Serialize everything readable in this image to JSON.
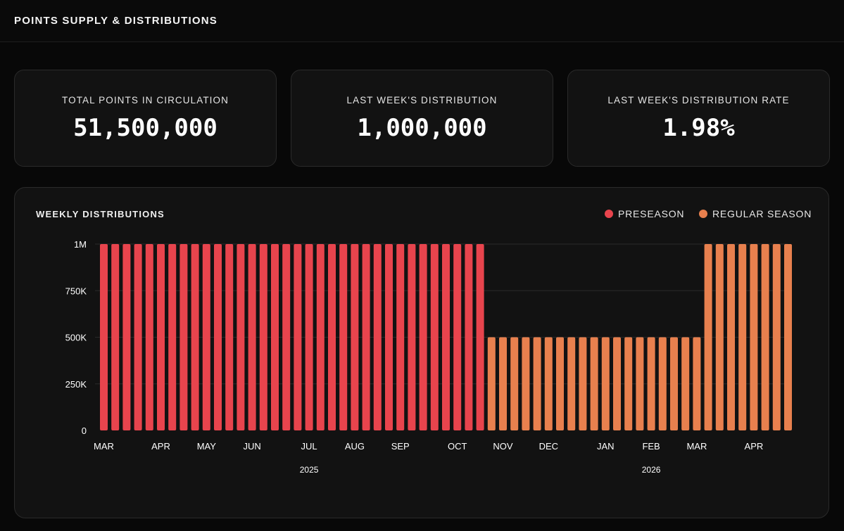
{
  "page": {
    "title": "POINTS SUPPLY & DISTRIBUTIONS"
  },
  "stats": [
    {
      "label": "TOTAL POINTS IN CIRCULATION",
      "value": "51,500,000"
    },
    {
      "label": "LAST WEEK'S DISTRIBUTION",
      "value": "1,000,000"
    },
    {
      "label": "LAST WEEK'S DISTRIBUTION RATE",
      "value": "1.98%"
    }
  ],
  "chart_card": {
    "title": "WEEKLY DISTRIBUTIONS",
    "legend": [
      {
        "label": "PRESEASON",
        "color": "#e8444d"
      },
      {
        "label": "REGULAR SEASON",
        "color": "#e8804e"
      }
    ]
  },
  "chart_data": {
    "type": "bar",
    "title": "WEEKLY DISTRIBUTIONS",
    "xlabel": "",
    "ylabel": "",
    "ylim": [
      0,
      1000000
    ],
    "yticks": [
      {
        "value": 0,
        "label": "0"
      },
      {
        "value": 250000,
        "label": "250K"
      },
      {
        "value": 500000,
        "label": "500K"
      },
      {
        "value": 750000,
        "label": "750K"
      },
      {
        "value": 1000000,
        "label": "1M"
      }
    ],
    "grid": true,
    "legend_position": "top-right",
    "month_labels": [
      {
        "label": "MAR",
        "week": 0
      },
      {
        "label": "APR",
        "week": 5
      },
      {
        "label": "MAY",
        "week": 9
      },
      {
        "label": "JUN",
        "week": 13
      },
      {
        "label": "JUL",
        "week": 18
      },
      {
        "label": "AUG",
        "week": 22
      },
      {
        "label": "SEP",
        "week": 26
      },
      {
        "label": "OCT",
        "week": 31
      },
      {
        "label": "NOV",
        "week": 35
      },
      {
        "label": "DEC",
        "week": 39
      },
      {
        "label": "JAN",
        "week": 44
      },
      {
        "label": "FEB",
        "week": 48
      },
      {
        "label": "MAR",
        "week": 52
      },
      {
        "label": "APR",
        "week": 57
      }
    ],
    "year_labels": [
      {
        "label": "2025",
        "week": 18
      },
      {
        "label": "2026",
        "week": 48
      }
    ],
    "series": [
      {
        "name": "PRESEASON",
        "color": "#e8444d",
        "values": [
          1000000,
          1000000,
          1000000,
          1000000,
          1000000,
          1000000,
          1000000,
          1000000,
          1000000,
          1000000,
          1000000,
          1000000,
          1000000,
          1000000,
          1000000,
          1000000,
          1000000,
          1000000,
          1000000,
          1000000,
          1000000,
          1000000,
          1000000,
          1000000,
          1000000,
          1000000,
          1000000,
          1000000,
          1000000,
          1000000,
          1000000,
          1000000,
          1000000,
          1000000
        ]
      },
      {
        "name": "REGULAR SEASON",
        "color": "#e8804e",
        "values": [
          500000,
          500000,
          500000,
          500000,
          500000,
          500000,
          500000,
          500000,
          500000,
          500000,
          500000,
          500000,
          500000,
          500000,
          500000,
          500000,
          500000,
          500000,
          500000,
          1000000,
          1000000,
          1000000,
          1000000,
          1000000,
          1000000,
          1000000,
          1000000
        ]
      }
    ]
  }
}
